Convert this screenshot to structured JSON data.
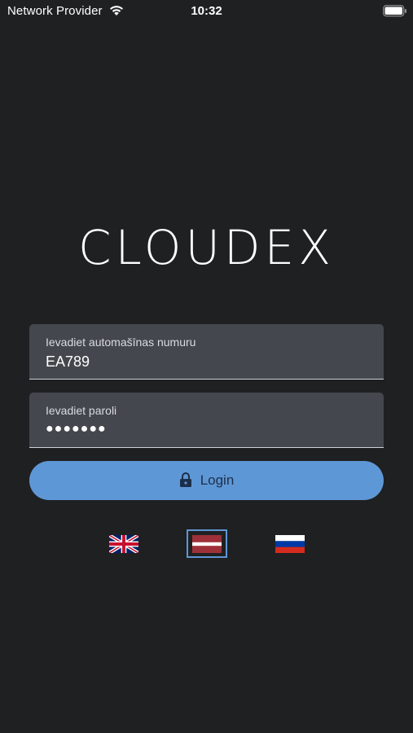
{
  "status_bar": {
    "carrier": "Network Provider",
    "time": "10:32",
    "icons": [
      "wifi-icon",
      "battery-icon"
    ]
  },
  "app": {
    "logo_text": "CLOUDEX"
  },
  "form": {
    "plate_label": "Ievadiet automašīnas numuru",
    "plate_value": "EA789",
    "password_label": "Ievadiet paroli",
    "password_value": "●●●●●●●"
  },
  "login_button": {
    "label": "Login",
    "icon": "lock-icon"
  },
  "languages": {
    "options": [
      "en",
      "lv",
      "ru"
    ],
    "selected": "lv"
  },
  "colors": {
    "background": "#1f2022",
    "field_bg": "#44474d",
    "accent": "#5e97d6",
    "button_text": "#1c2f4a"
  }
}
